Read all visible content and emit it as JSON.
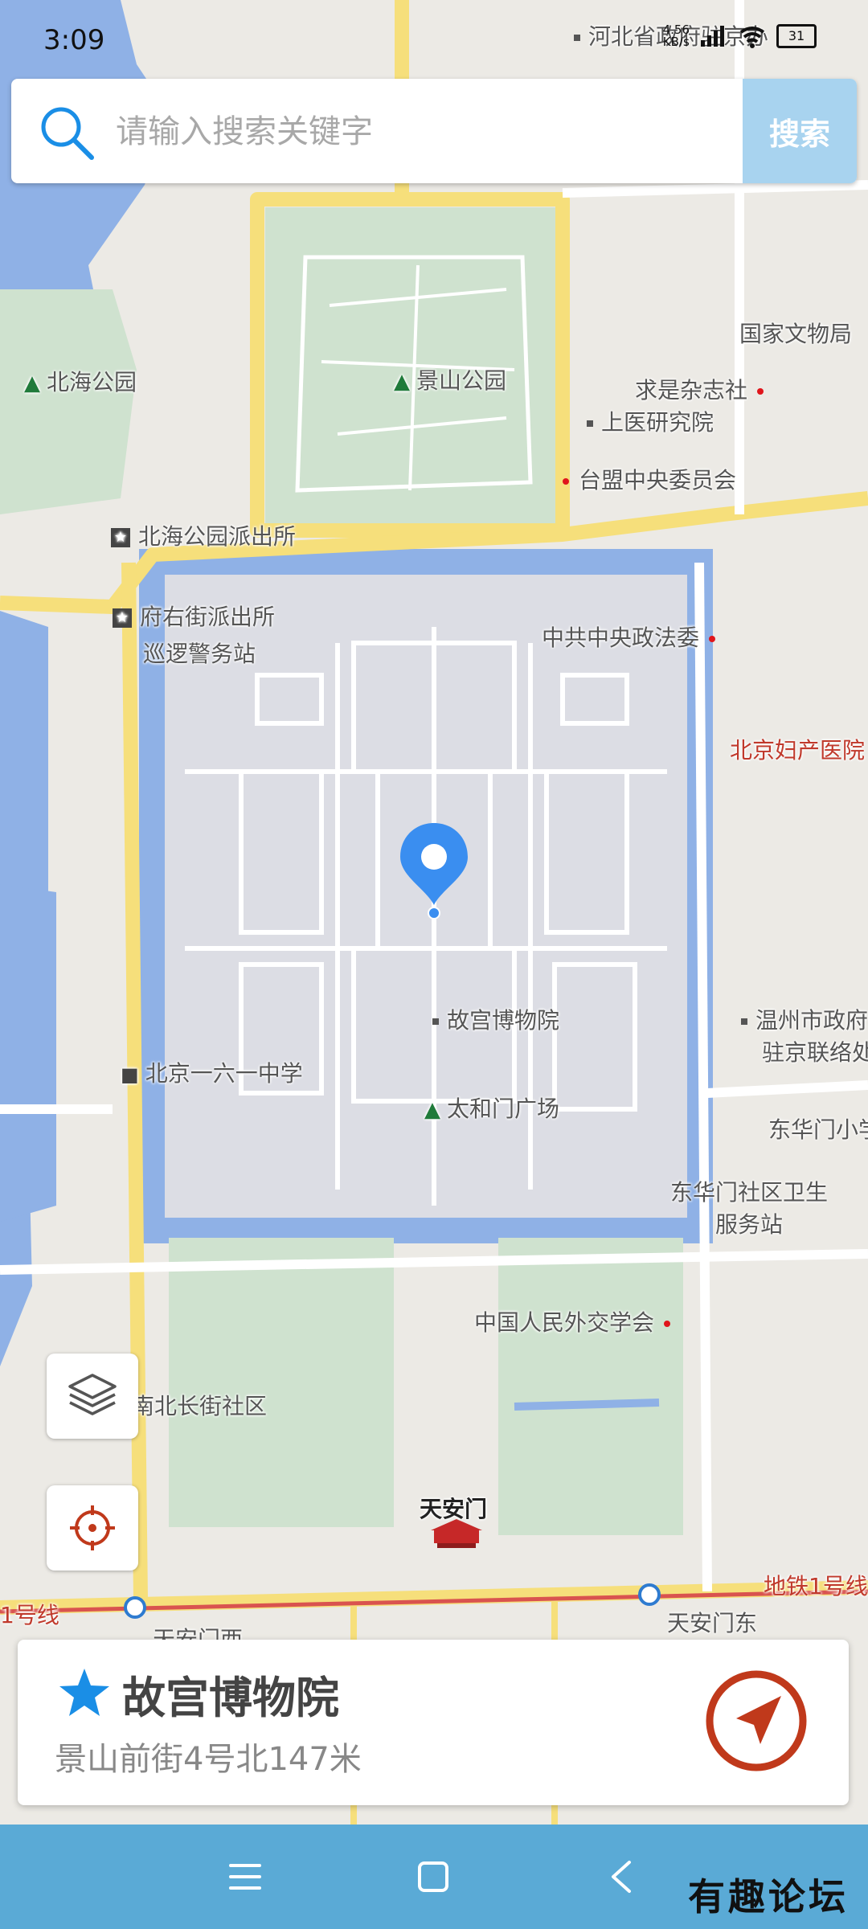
{
  "status_bar": {
    "time": "3:09",
    "net_speed_value": "4.56",
    "net_speed_unit": "KB/s",
    "battery": "31"
  },
  "search": {
    "placeholder": "请输入搜索关键字",
    "button_label": "搜索"
  },
  "map_labels": {
    "hebei_office": "河北省政府驻京办",
    "national_cultural_heritage": "国家文物局",
    "qiushi": "求是杂志社",
    "shangyi": "上医研究院",
    "taimeng": "台盟中央委员会",
    "beihai_park": "北海公园",
    "jingshan_park": "景山公园",
    "beihai_police": "北海公园派出所",
    "fuyoujie_police": "府右街派出所",
    "patrol_police": "巡逻警务站",
    "central_political_legal": "中共中央政法委",
    "beijing_maternity": "北京妇产医院",
    "palace_museum": "故宫博物院",
    "wenzhou_office_line1": "温州市政府",
    "wenzhou_office_line2": "驻京联络处",
    "beijing_161_school": "北京一六一中学",
    "taihemen_square": "太和门广场",
    "donghuamen_school": "东华门小学",
    "donghuamen_health_line1": "东华门社区卫生",
    "donghuamen_health_line2": "服务站",
    "foreign_affairs_society": "中国人民外交学会",
    "nanchang_community": "南北长街社区",
    "tiananmen": "天安门",
    "subway_line1_right": "地铁1号线",
    "subway_line1_left": "1号线",
    "tiananmen_west": "天安门西",
    "tiananmen_east": "天安门东"
  },
  "icons": {
    "layers": "layers-icon",
    "locate": "crosshair-icon",
    "marker": "map-pin-icon",
    "star": "star-icon",
    "navigate": "navigation-arrow-icon"
  },
  "info_card": {
    "name": "故宫博物院",
    "address": "景山前街4号北147米"
  },
  "colors": {
    "accent_blue": "#1a8ee6",
    "search_button": "#a8d3ef",
    "navigate_red": "#c0391b",
    "nav_bar": "#5aaad6",
    "road_yellow": "#f6df7b",
    "water": "#8fb1e6"
  },
  "watermark": "有趣论坛"
}
